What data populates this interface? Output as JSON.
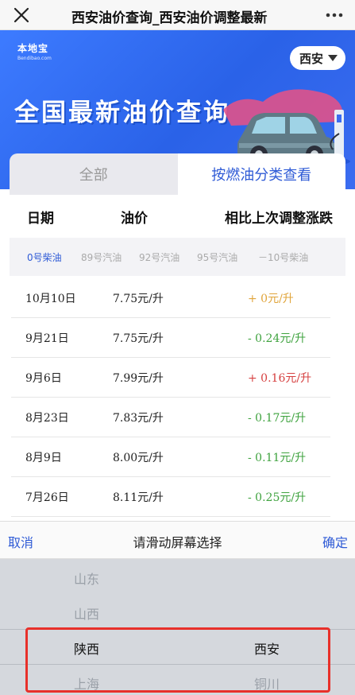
{
  "window": {
    "title": "西安油价查询_西安油价调整最新"
  },
  "banner": {
    "logo_cn": "本地宝",
    "logo_en": "Bendibao.com",
    "city": "西安",
    "hero": "全国最新油价查询",
    "accent_color": "#2a62e8"
  },
  "tabs": [
    {
      "label": "全部"
    },
    {
      "label": "按燃油分类查看"
    }
  ],
  "table": {
    "headers": [
      "日期",
      "油价",
      "相比上次调整涨跌"
    ],
    "fuel_types": [
      "0号柴油",
      "89号汽油",
      "92号汽油",
      "95号汽油",
      "－10号柴油"
    ],
    "rows": [
      {
        "date": "10月10日",
        "price": "7.75元/升",
        "change": "+ 0元/升",
        "trend": "zero"
      },
      {
        "date": "9月21日",
        "price": "7.75元/升",
        "change": "- 0.24元/升",
        "trend": "down"
      },
      {
        "date": "9月6日",
        "price": "7.99元/升",
        "change": "+ 0.16元/升",
        "trend": "up"
      },
      {
        "date": "8月23日",
        "price": "7.83元/升",
        "change": "- 0.17元/升",
        "trend": "down"
      },
      {
        "date": "8月9日",
        "price": "8.00元/升",
        "change": "- 0.11元/升",
        "trend": "down"
      },
      {
        "date": "7月26日",
        "price": "8.11元/升",
        "change": "- 0.25元/升",
        "trend": "down"
      }
    ]
  },
  "picker": {
    "cancel": "取消",
    "title": "请滑动屏幕选择",
    "confirm": "确定",
    "provinces": [
      "山东",
      "山西",
      "陕西",
      "上海"
    ],
    "cities": [
      "西安",
      "铜川"
    ],
    "selected_province": "陕西",
    "selected_city": "西安"
  }
}
